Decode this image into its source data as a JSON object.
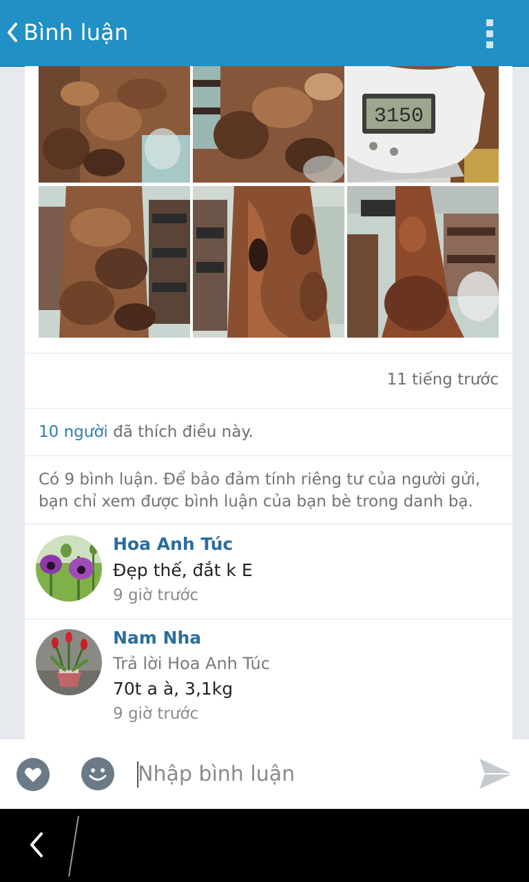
{
  "header": {
    "title": "Bình luận"
  },
  "post": {
    "time": "11 tiếng trước",
    "likes_count": "10 người",
    "likes_text": " đã thích điều này.",
    "privacy_note": "Có 9 bình luận. Để bảo đảm tính riêng tư của người gửi, bạn chỉ xem được bình luận của bạn bè trong danh bạ.",
    "scale_reading": "3150"
  },
  "comments": [
    {
      "author": "Hoa Anh Túc",
      "text": "Đẹp thế, đắt k E",
      "time": "9 giờ trước"
    },
    {
      "author": "Nam Nha",
      "reply_to": "Trả lời Hoa Anh Túc",
      "text": "70t a à, 3,1kg",
      "time": "9 giờ trước"
    }
  ],
  "input": {
    "placeholder": "Nhập bình luận"
  },
  "colors": {
    "header": "#2190c4",
    "link": "#2b7fb3",
    "name": "#2b6d9e"
  },
  "icons": {
    "back": "chevron-left-icon",
    "menu": "more-vertical-icon",
    "like": "heart-icon",
    "emoji": "emoji-icon",
    "send": "send-icon"
  }
}
